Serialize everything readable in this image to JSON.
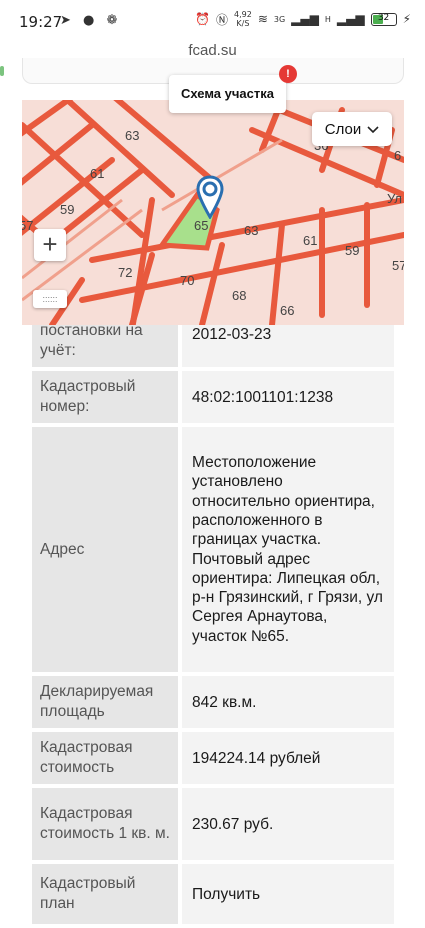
{
  "status": {
    "time": "19:27",
    "left_icons": "telegram-icon moon-icon cluster-icon",
    "net_speed_value": "4,92",
    "net_speed_unit": "K/S",
    "battery": "32",
    "signal1": "3G",
    "signal2": "H"
  },
  "browser": {
    "url": "fcad.su"
  },
  "map": {
    "title": "Схема участка",
    "alert": "!",
    "layers_label": "Слои",
    "zoom_in": "+",
    "street_label": "Ул",
    "parcel_labels": [
      "63",
      "61",
      "59",
      "57",
      "65",
      "63",
      "61",
      "59",
      "72",
      "70",
      "68",
      "66",
      "36",
      "57",
      "6"
    ],
    "highlight_color": "#a8e08c",
    "line_color": "#e8593d"
  },
  "table": {
    "rows": [
      {
        "label_lines": [
          "постановки на",
          "учёт:"
        ],
        "value": "2012-03-23"
      },
      {
        "label": "Кадастровый номер:",
        "value": "48:02:1001101:1238"
      },
      {
        "label": "Адрес",
        "value": "Местоположение установлено относительно ориентира, расположенного в границах участка. Почтовый адрес ориентира: Липецкая обл, р-н Грязинский, г Грязи, ул Сергея Арнаутова, участок №65."
      },
      {
        "label": "Декларируемая площадь",
        "value": "842 кв.м."
      },
      {
        "label": "Кадастровая стоимость",
        "value": "194224.14 рублей"
      },
      {
        "label": "Кадастровая стоимость 1 кв. м.",
        "value": "230.67 руб."
      },
      {
        "label": "Кадастровый план",
        "value": "Получить"
      }
    ]
  }
}
